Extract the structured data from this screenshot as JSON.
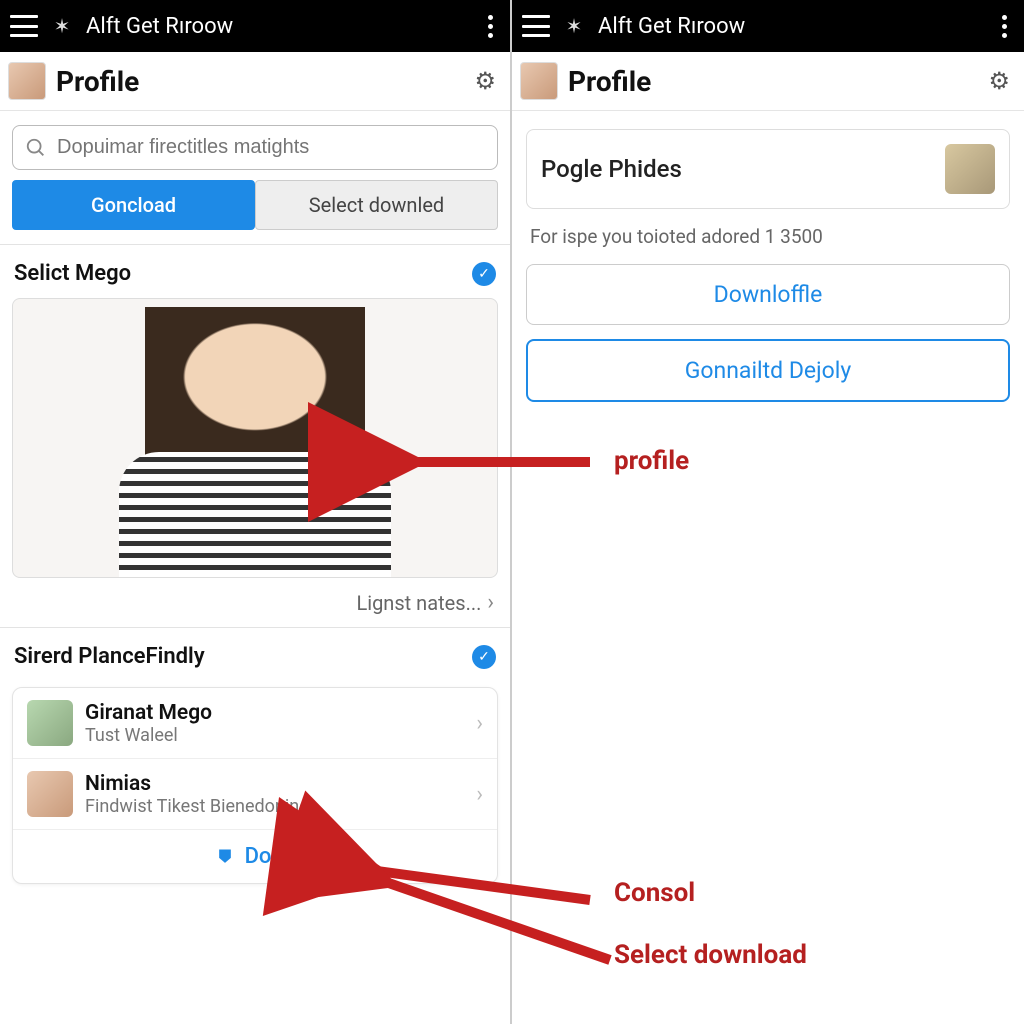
{
  "left": {
    "topbar": {
      "title": "Alft Get Rıroow"
    },
    "profile_label": "Profile",
    "search": {
      "placeholder": "Dopuimar firectitles matights"
    },
    "tabs": {
      "primary": "Goncload",
      "secondary": "Select downled"
    },
    "section1": {
      "title": "Selict Mego",
      "subaction": "Lignst nates..."
    },
    "section2": {
      "title": "Sirerd PlanceFindly",
      "items": [
        {
          "title": "Giranat Mego",
          "sub": "Tust Waleel"
        },
        {
          "title": "Nimias",
          "sub": "Findwist Tikest Bienedoning"
        }
      ],
      "done": "Done"
    }
  },
  "right": {
    "topbar": {
      "title": "Alft Get Rıroow"
    },
    "profile_label": "Profile",
    "card": {
      "name": "Pogle Phides"
    },
    "desc": "For ispe you toioted adored 1 3500",
    "buttons": {
      "a": "Downloffle",
      "b": "Gonnailtd Dejoly"
    }
  },
  "annotations": {
    "profile": "profile",
    "consol": "Consol",
    "select": "Select download"
  }
}
